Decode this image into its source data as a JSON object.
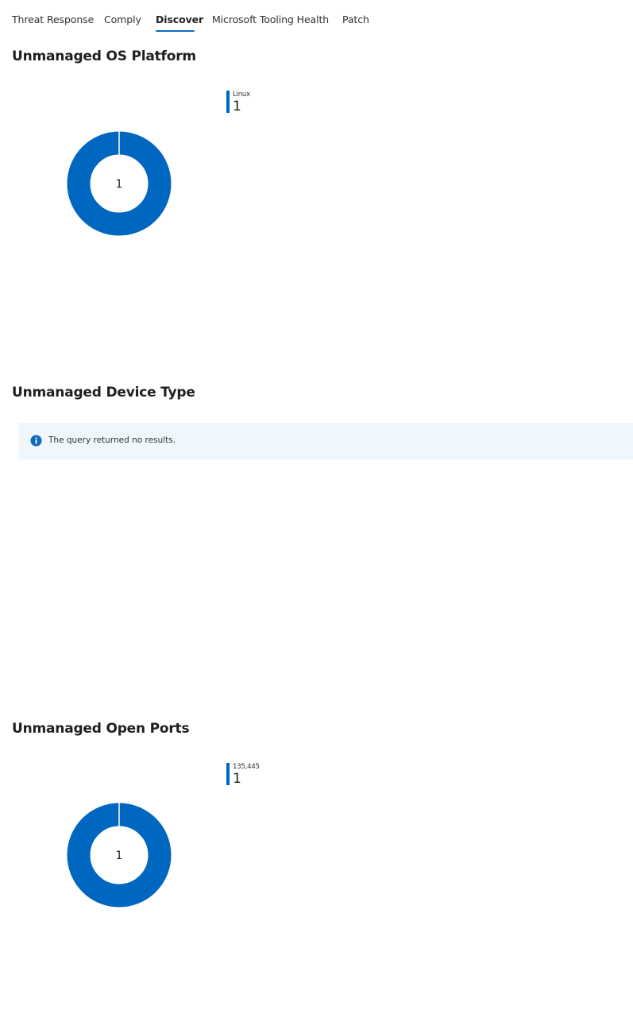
{
  "tabs": [
    {
      "label": "Threat Response",
      "active": false
    },
    {
      "label": "Comply",
      "active": false
    },
    {
      "label": "Discover",
      "active": true
    },
    {
      "label": "Microsoft Tooling Health",
      "active": false
    },
    {
      "label": "Patch",
      "active": false
    }
  ],
  "sections": {
    "os_platform": {
      "title": "Unmanaged OS Platform",
      "center_label": "1",
      "legend": {
        "label": "Linux",
        "value": "1"
      }
    },
    "device_type": {
      "title": "Unmanaged Device Type",
      "message": "The query returned no results.",
      "message_icon": "info-icon"
    },
    "open_ports": {
      "title": "Unmanaged Open Ports",
      "center_label": "1",
      "legend": {
        "label": "135,445",
        "value": "1"
      }
    }
  },
  "colors": {
    "accent": "#0f6cbd",
    "donut": "#0067c0",
    "message_bg": "#eff6fc",
    "info_icon": "#0f6cbd"
  },
  "chart_data": [
    {
      "type": "pie",
      "categories": [
        "Linux"
      ],
      "values": [
        1
      ],
      "title": "Unmanaged OS Platform"
    },
    {
      "type": "pie",
      "categories": [
        "135,445"
      ],
      "values": [
        1
      ],
      "title": "Unmanaged Open Ports"
    }
  ]
}
